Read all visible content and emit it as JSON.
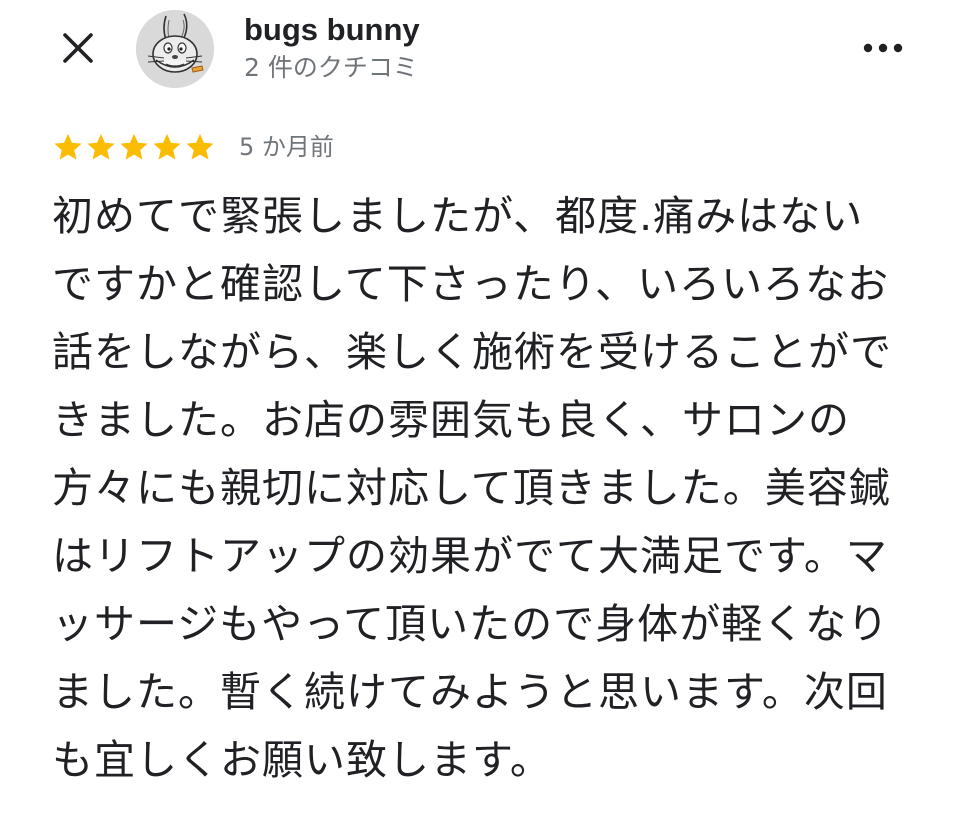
{
  "header": {
    "user_name": "bugs bunny",
    "review_count": "2 件のクチコミ",
    "close_icon": "close-icon",
    "more_icon": "more-horizontal-icon",
    "avatar_icon": "bugs-bunny-avatar"
  },
  "review": {
    "rating": 5,
    "max_rating": 5,
    "star_color": "#fbbc04",
    "date": "5 か月前",
    "text": "初めてで緊張しましたが、都度.痛みはないですかと確認して下さったり、いろいろなお話をしながら、楽しく施術を受けることができました。お店の雰囲気も良く、サロンの方々にも親切に対応して頂きました。美容鍼はリフトアップの効果がでて大満足です。マッサージもやって頂いたので身体が軽くなりました。暫く続けてみようと思います。次回も宜しくお願い致します。"
  }
}
